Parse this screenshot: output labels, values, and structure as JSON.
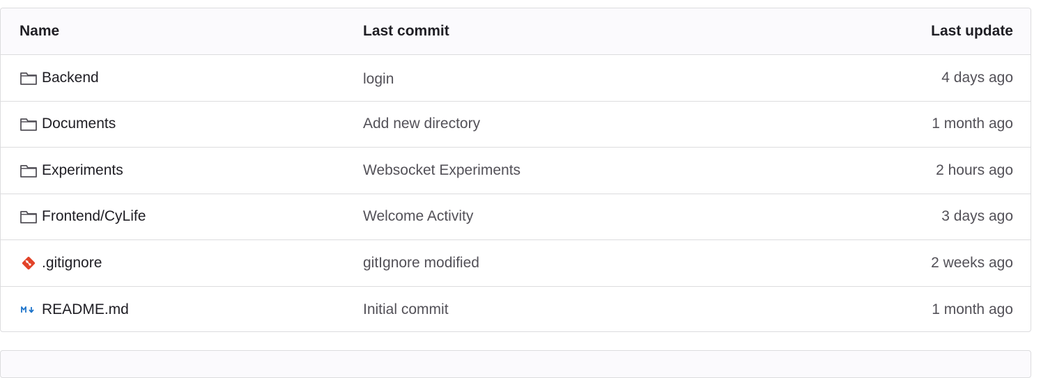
{
  "table": {
    "headers": {
      "name": "Name",
      "last_commit": "Last commit",
      "last_update": "Last update"
    },
    "rows": [
      {
        "icon": "folder-icon",
        "name": "Backend",
        "commit": "login",
        "updated": "4 days ago"
      },
      {
        "icon": "folder-icon",
        "name": "Documents",
        "commit": "Add new directory",
        "updated": "1 month ago"
      },
      {
        "icon": "folder-icon",
        "name": "Experiments",
        "commit": "Websocket Experiments",
        "updated": "2 hours ago"
      },
      {
        "icon": "folder-icon",
        "name": "Frontend/CyLife",
        "commit": "Welcome Activity",
        "updated": "3 days ago"
      },
      {
        "icon": "git-icon",
        "name": ".gitignore",
        "commit": "gitIgnore modified",
        "updated": "2 weeks ago"
      },
      {
        "icon": "markdown-icon",
        "name": "README.md",
        "commit": "Initial commit",
        "updated": "1 month ago"
      }
    ]
  },
  "colors": {
    "border": "#dcdcde",
    "header_bg": "#fbfafd",
    "text_primary": "#1f1e24",
    "text_secondary": "#535158",
    "git_icon": "#e24329",
    "markdown_icon": "#1f75cb"
  }
}
